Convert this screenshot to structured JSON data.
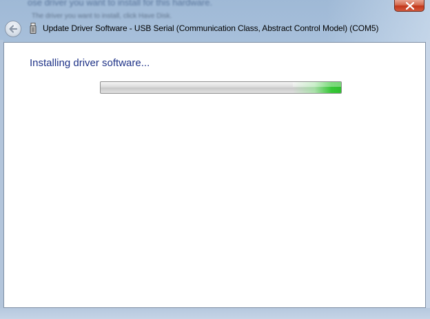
{
  "background": {
    "line1": "ose driver you want to install for this hardware.",
    "line2": "The driver you want to install, click Have Disk."
  },
  "window": {
    "title": "Update Driver Software - USB Serial (Communication Class, Abstract Control Model) (COM5)"
  },
  "content": {
    "heading": "Installing driver software...",
    "progress_style": "marquee (indeterminate)",
    "progress_highlight_fraction": 0.2
  },
  "icons": {
    "back": "back-arrow-icon",
    "device": "usb-device-icon",
    "close": "close-icon"
  },
  "colors": {
    "heading": "#1e3287",
    "progress_green": "#37c737",
    "close_red": "#c2361a"
  }
}
